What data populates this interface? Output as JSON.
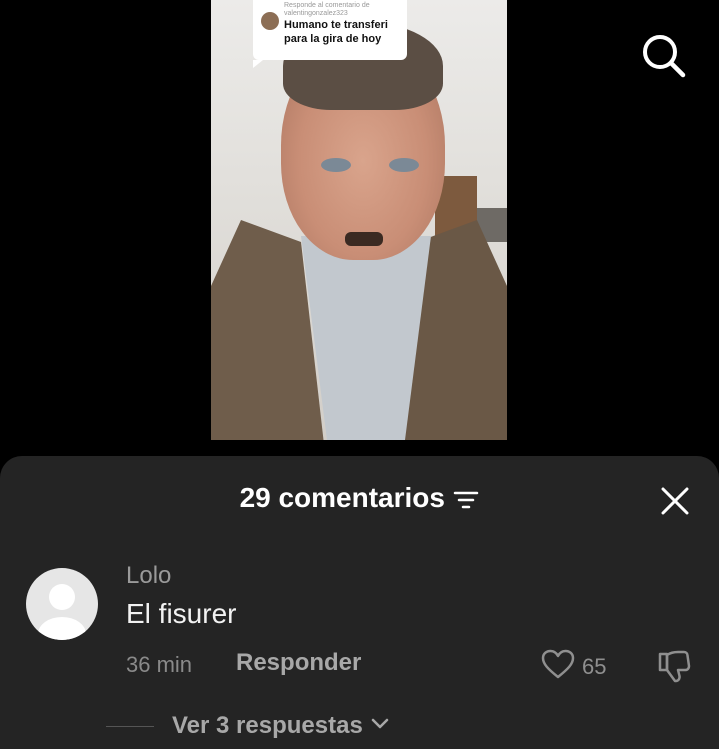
{
  "video": {
    "reply_prefix": "Responde al comentario de",
    "reply_username": "valentingonzalez323",
    "reply_text_line1": "Humano te transferi",
    "reply_text_line2": "para la gira de hoy"
  },
  "header": {
    "search_icon": "search-icon"
  },
  "comments_sheet": {
    "title": "29 comentarios",
    "filter_icon": "filter-icon",
    "close_icon": "close-icon",
    "comment": {
      "username": "Lolo",
      "text": "El fisurer",
      "time": "36 min",
      "reply_label": "Responder",
      "likes": "65",
      "like_icon": "heart-icon",
      "dislike_icon": "thumbs-down-icon"
    },
    "view_replies": "Ver 3 respuestas"
  }
}
